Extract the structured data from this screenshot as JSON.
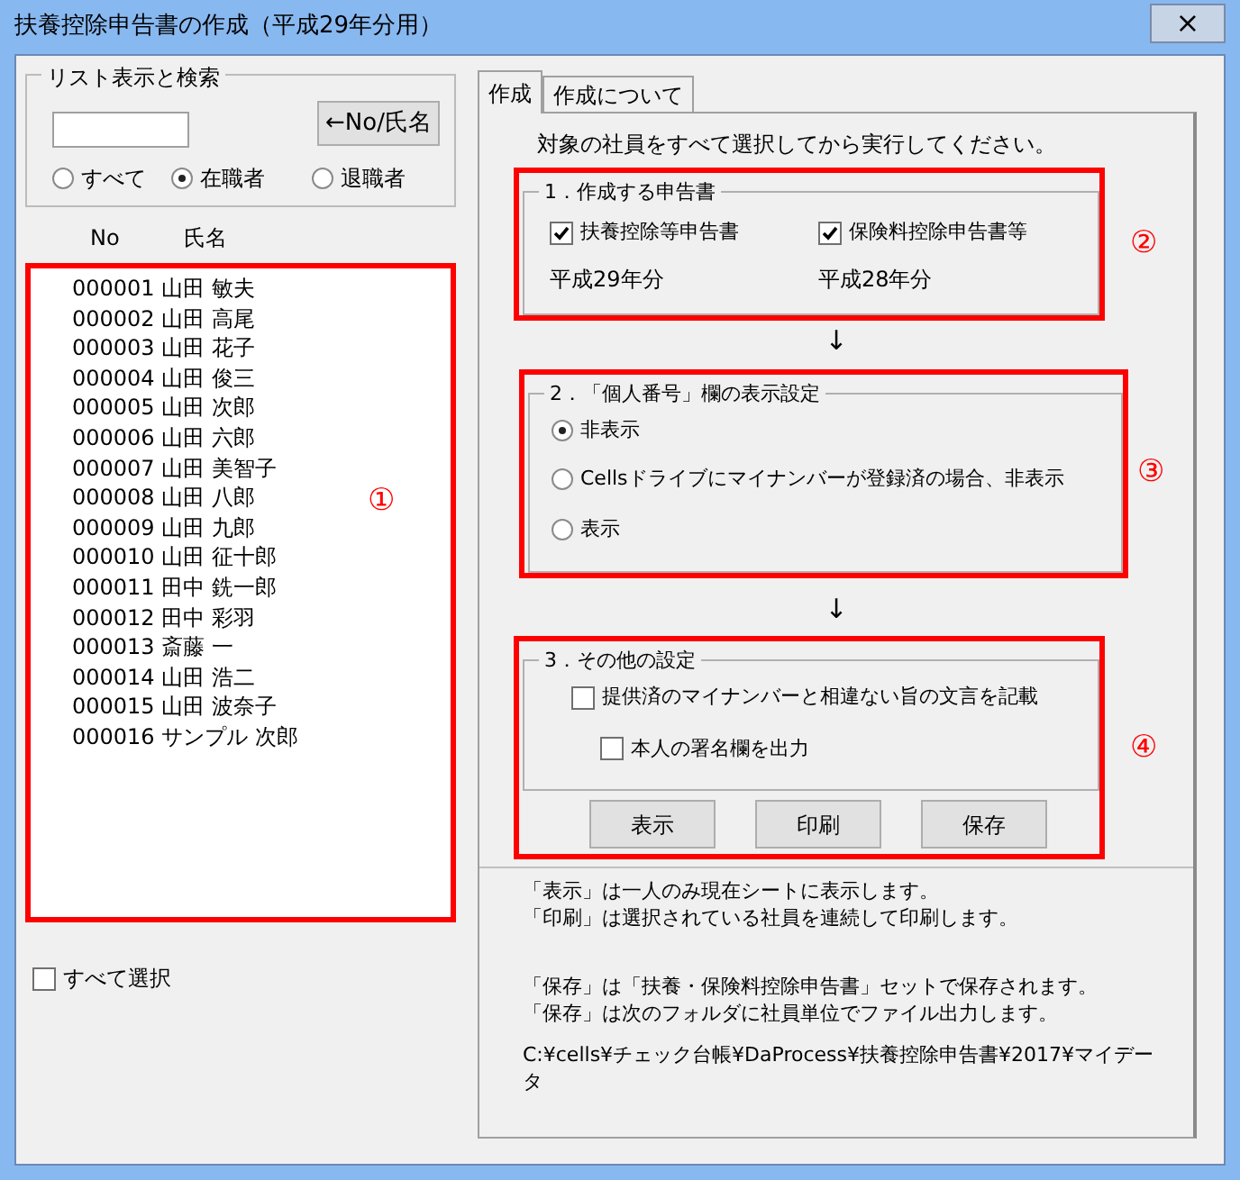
{
  "window": {
    "title": "扶養控除申告書の作成（平成29年分用）",
    "close": "×"
  },
  "search_group": {
    "title": "リスト表示と検索",
    "button": "←No/氏名",
    "filters": [
      {
        "label": "すべて",
        "selected": false
      },
      {
        "label": "在職者",
        "selected": true
      },
      {
        "label": "退職者",
        "selected": false
      }
    ]
  },
  "list": {
    "columns": [
      "No",
      "氏名"
    ],
    "annotation": "①",
    "rows": [
      {
        "no": "000001",
        "name": "山田 敏夫"
      },
      {
        "no": "000002",
        "name": "山田 高尾"
      },
      {
        "no": "000003",
        "name": "山田 花子"
      },
      {
        "no": "000004",
        "name": "山田 俊三"
      },
      {
        "no": "000005",
        "name": "山田 次郎"
      },
      {
        "no": "000006",
        "name": "山田 六郎"
      },
      {
        "no": "000007",
        "name": "山田 美智子"
      },
      {
        "no": "000008",
        "name": "山田 八郎"
      },
      {
        "no": "000009",
        "name": "山田 九郎"
      },
      {
        "no": "000010",
        "name": "山田 征十郎"
      },
      {
        "no": "000011",
        "name": "田中 銑一郎"
      },
      {
        "no": "000012",
        "name": "田中 彩羽"
      },
      {
        "no": "000013",
        "name": "斎藤 一"
      },
      {
        "no": "000014",
        "name": "山田 浩二"
      },
      {
        "no": "000015",
        "name": "山田 波奈子"
      },
      {
        "no": "000016",
        "name": "サンプル 次郎"
      }
    ]
  },
  "select_all": {
    "label": "すべて選択",
    "checked": false
  },
  "tabs": [
    {
      "label": "作成",
      "selected": true
    },
    {
      "label": "作成について",
      "selected": false
    }
  ],
  "instruction": "対象の社員をすべて選択してから実行してください。",
  "sections": [
    {
      "kind": "forms",
      "title": "1．作成する申告書",
      "annotation": "②",
      "items": [
        {
          "label": "扶養控除等申告書",
          "checked": true,
          "note": "平成29年分"
        },
        {
          "label": "保険料控除申告書等",
          "checked": true,
          "note": "平成28年分"
        }
      ]
    },
    {
      "kind": "radios",
      "arrow": "↓",
      "title": "2．「個人番号」欄の表示設定",
      "annotation": "③",
      "items": [
        {
          "label": "非表示",
          "selected": true
        },
        {
          "label": "Cellsドライブにマイナンバーが登録済の場合、非表示",
          "selected": false
        },
        {
          "label": "表示",
          "selected": false
        }
      ]
    },
    {
      "kind": "options",
      "arrow": "↓",
      "title": "3．その他の設定",
      "annotation": "④",
      "items": [
        {
          "label": "提供済のマイナンバーと相違ない旨の文言を記載",
          "checked": false
        },
        {
          "label": "本人の署名欄を出力",
          "checked": false
        }
      ],
      "buttons": [
        "表示",
        "印刷",
        "保存"
      ]
    }
  ],
  "notes": [
    [
      "「表示」は一人のみ現在シートに表示します。",
      "「印刷」は選択されている社員を連続して印刷します。"
    ],
    [
      "「保存」は「扶養・保険料控除申告書」セットで保存されます。",
      "「保存」は次のフォルダに社員単位でファイル出力します。"
    ],
    [
      "C:¥cells¥チェック台帳¥DaProcess¥扶養控除申告書¥2017¥マイデータ"
    ]
  ]
}
